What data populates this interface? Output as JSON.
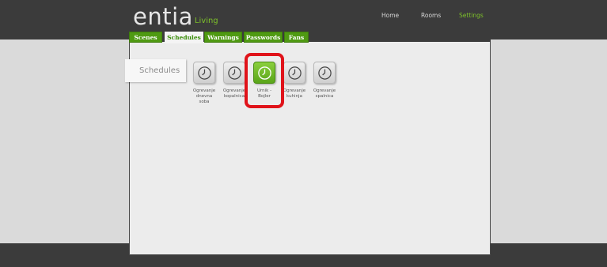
{
  "app": {
    "logo_text": "entia",
    "logo_sub": "Living"
  },
  "top_nav": {
    "home": "Home",
    "rooms": "Rooms",
    "settings": "Settings",
    "active": "settings"
  },
  "tabs": [
    {
      "label": "Scenes",
      "active": false
    },
    {
      "label": "Schedules",
      "active": true
    },
    {
      "label": "Warnings",
      "active": false
    },
    {
      "label": "Passwords",
      "active": false
    },
    {
      "label": "Fans",
      "active": false
    }
  ],
  "section_label": "Schedules",
  "schedules": [
    {
      "label_lines": [
        "Ogrevanje",
        "dnevna",
        "soba"
      ],
      "active": false,
      "icon": "clock-icon"
    },
    {
      "label_lines": [
        "Ogrevanje",
        "kopalnica",
        ""
      ],
      "active": false,
      "icon": "clock-icon"
    },
    {
      "label_lines": [
        "Urnik -",
        "Bojler",
        ""
      ],
      "active": true,
      "icon": "clock-icon"
    },
    {
      "label_lines": [
        "Ogrevanje",
        "kuhinja",
        ""
      ],
      "active": false,
      "icon": "clock-icon"
    },
    {
      "label_lines": [
        "Ogrevanje",
        "spalnica",
        ""
      ],
      "active": false,
      "icon": "clock-icon"
    }
  ],
  "colors": {
    "accent_green": "#7dc02a",
    "tab_green": "#4f9a12",
    "highlight_red": "#e0131a",
    "dark_bar": "#3b3b3b"
  }
}
